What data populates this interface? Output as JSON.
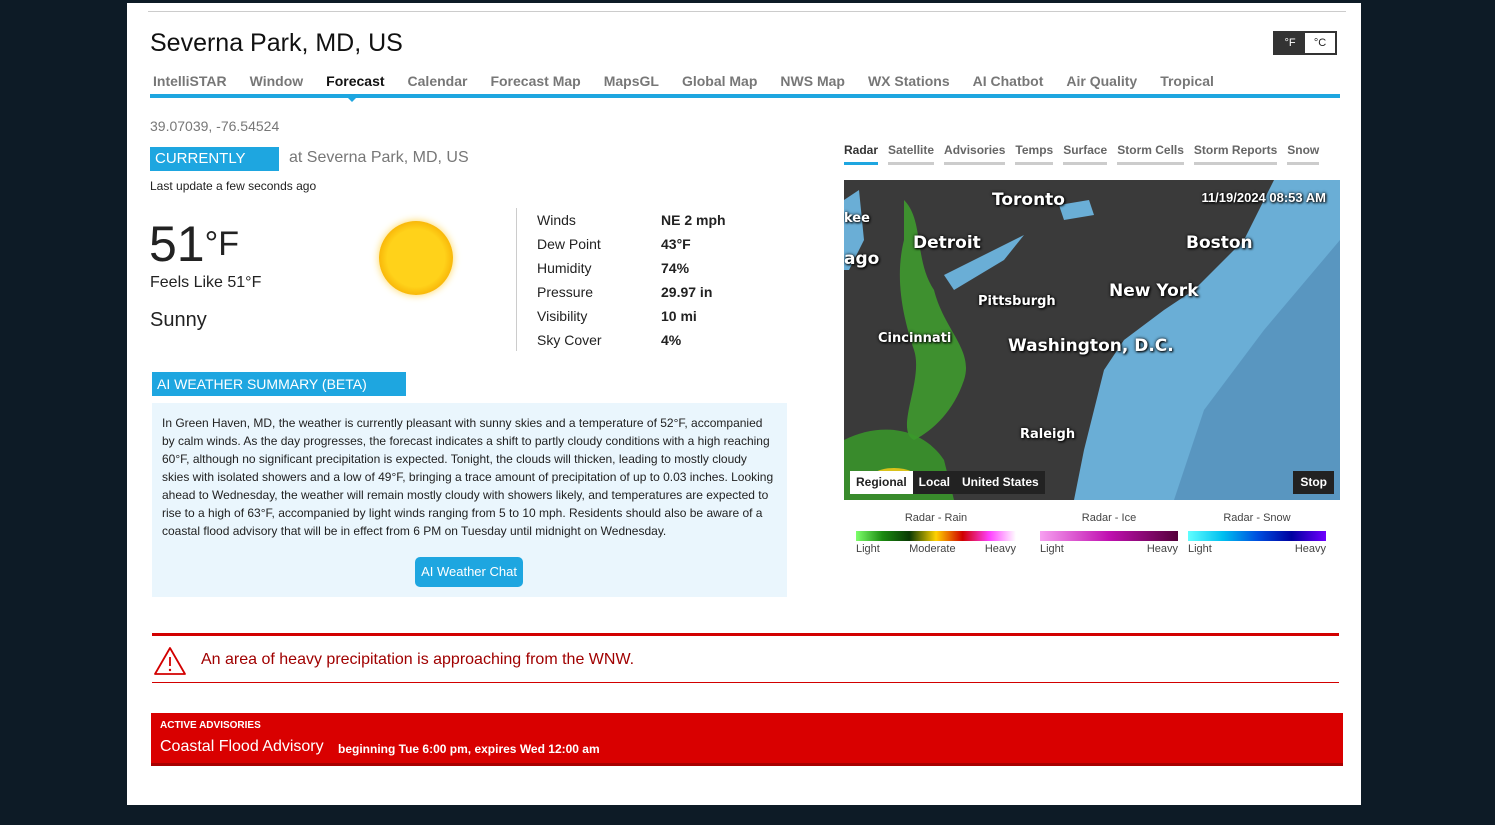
{
  "header": {
    "title": "Severna Park, MD, US",
    "unit_f": "°F",
    "unit_c": "°C",
    "selected_unit": "°F"
  },
  "nav": {
    "items": [
      "IntelliSTAR",
      "Window",
      "Forecast",
      "Calendar",
      "Forecast Map",
      "MapsGL",
      "Global Map",
      "NWS Map",
      "WX Stations",
      "AI Chatbot",
      "Air Quality",
      "Tropical"
    ],
    "active": "Forecast"
  },
  "location": {
    "coords": "39.07039, -76.54524"
  },
  "current": {
    "badge": "CURRENTLY",
    "at": "at Severna Park, MD, US",
    "updated": "Last update a few seconds ago",
    "temp": "51",
    "temp_unit": "°F",
    "feels_like": "Feels Like 51°F",
    "condition": "Sunny",
    "icon": "sun-icon",
    "obs": [
      {
        "k": "Winds",
        "v": "NE 2 mph"
      },
      {
        "k": "Dew Point",
        "v": "43°F"
      },
      {
        "k": "Humidity",
        "v": "74%"
      },
      {
        "k": "Pressure",
        "v": "29.97 in"
      },
      {
        "k": "Visibility",
        "v": "10 mi"
      },
      {
        "k": "Sky Cover",
        "v": "4%"
      }
    ]
  },
  "ai": {
    "title": "AI WEATHER SUMMARY (BETA)",
    "text": "In Green Haven, MD, the weather is currently pleasant with sunny skies and a temperature of 52°F, accompanied by calm winds. As the day progresses, the forecast indicates a shift to partly cloudy conditions with a high reaching 60°F, although no significant precipitation is expected. Tonight, the clouds will thicken, leading to mostly cloudy skies with isolated showers and a low of 49°F, bringing a trace amount of precipitation of up to 0.03 inches. Looking ahead to Wednesday, the weather will remain mostly cloudy with showers likely, and temperatures are expected to rise to a high of 63°F, accompanied by light winds ranging from 5 to 10 mph. Residents should also be aware of a coastal flood advisory that will be in effect from 6 PM on Tuesday until midnight on Wednesday.",
    "button": "AI Weather Chat"
  },
  "map": {
    "tabs": [
      "Radar",
      "Satellite",
      "Advisories",
      "Temps",
      "Surface",
      "Storm Cells",
      "Storm Reports",
      "Snow"
    ],
    "active": "Radar",
    "timestamp": "11/19/2024 08:53 AM",
    "cities": [
      "Toronto",
      "Detroit",
      "Boston",
      "New York",
      "Pittsburgh",
      "Cincinnati",
      "Washington, D.C.",
      "Raleigh",
      "kee",
      "ago"
    ],
    "scope_buttons": [
      "Regional",
      "Local",
      "United States"
    ],
    "scope_selected": "Regional",
    "stop": "Stop",
    "legends": [
      {
        "title": "Radar - Rain",
        "labels": [
          "Light",
          "Moderate",
          "Heavy"
        ]
      },
      {
        "title": "Radar - Ice",
        "labels": [
          "Light",
          "Heavy"
        ]
      },
      {
        "title": "Radar - Snow",
        "labels": [
          "Light",
          "Heavy"
        ]
      }
    ]
  },
  "alert": {
    "icon": "warning-triangle-icon",
    "text": "An area of heavy precipitation is approaching from the WNW."
  },
  "advisories": {
    "heading": "ACTIVE ADVISORIES",
    "name": "Coastal Flood Advisory",
    "detail": "beginning Tue 6:00 pm, expires Wed 12:00 am"
  },
  "colors": {
    "accent": "#1ea6e0",
    "alert": "#d90000"
  }
}
